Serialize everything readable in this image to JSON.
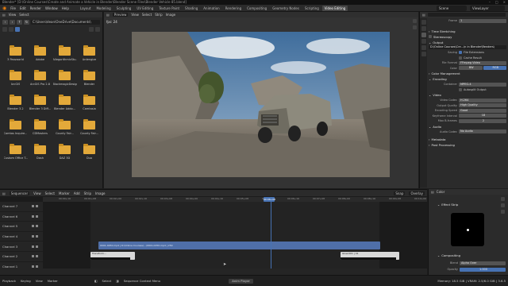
{
  "titlebar": {
    "text": "Blender* [D:\\Online Courses\\Create and Animate a Vehicle in Blender\\Blender Scene Files\\Blender Vehicle 85.blend]"
  },
  "menubar": {
    "menus": [
      "File",
      "Edit",
      "Render",
      "Window",
      "Help"
    ],
    "workspaces": [
      "Layout",
      "Modeling",
      "Sculpting",
      "UV Editing",
      "Texture Paint",
      "Shading",
      "Animation",
      "Rendering",
      "Compositing",
      "Geometry Nodes",
      "Scripting",
      "Video Editing"
    ],
    "active_workspace": "Video Editing",
    "scene": "Scene",
    "view_layer": "ViewLayer"
  },
  "file_browser": {
    "header_items": [
      "View",
      "Select"
    ],
    "path": "C:\\Users\\dean\\OneDrive\\Documents\\",
    "folders": [
      "3 Passworld",
      "Adobe",
      "AllegorithmicStu...",
      "Ardengize",
      "ArcGIS",
      "ArcGIS Pro 2.8",
      "BlackmagicDesign",
      "Blender",
      "Blender 3.2",
      "Blender 3 Diff...",
      "Blender Addo...",
      "Camtasia",
      "Camtas Inquire...",
      "CDMasters",
      "County Fair...",
      "County Fair...",
      "Custom Office T...",
      "Dash",
      "DAZ 3D",
      "Duo"
    ]
  },
  "preview": {
    "header_items": [
      "View",
      "Select",
      "Strip",
      "Image"
    ],
    "mode": "Preview",
    "fps": "fps: 24"
  },
  "properties": {
    "frame_label": "Frame",
    "frame_value": "1",
    "fields": {
      "time_stretching": "Time Stretching",
      "stereoscopy": "Stereoscopy",
      "output": "Output",
      "output_path": "D:\\Online Courses\\Cre...\\n in Blender\\Renders\\",
      "saving": "Saving",
      "file_extensions": "File Extensions",
      "cache_result": "Cache Result",
      "file_format_label": "File Format",
      "file_format": "FFmpeg Video",
      "color_label": "Color",
      "color_bw": "BW",
      "color_rgb": "RGB",
      "color_management": "Color Management",
      "encoding": "Encoding",
      "container_label": "Container",
      "container": "MPEG-4",
      "autosplit": "Autosplit Output",
      "video": "Video",
      "codec_label": "Video Codec",
      "codec": "H.264",
      "quality_label": "Output Quality",
      "quality": "High Quality",
      "speed_label": "Encoding Speed",
      "speed": "Good",
      "keyframe_label": "Keyframe Interval",
      "keyframe": "18",
      "bframes_label": "Max B-frames",
      "bframes": "2",
      "audio": "Audio",
      "audio_codec_label": "Audio Codec",
      "audio_codec": "No Audio",
      "metadata": "Metadata",
      "post_processing": "Post Processing"
    }
  },
  "sequencer": {
    "header_items": [
      "Sequencer",
      "View",
      "Select",
      "Marker",
      "Add",
      "Strip",
      "Image"
    ],
    "snap_label": "Snap",
    "overlay_label": "Overlay",
    "ruler_ticks": [
      "00:00+16",
      "00:01+08",
      "00:02+00",
      "00:02+16",
      "00:03+08",
      "00:04+00",
      "00:04+16",
      "00:05+08",
      "00:06+00",
      "00:06+16",
      "00:07+08",
      "00:08+00",
      "00:08+16",
      "00:09+08",
      "00:10+00"
    ],
    "playhead_time": "00:06+08",
    "channels": [
      "Channel 7",
      "Channel 6",
      "Channel 5",
      "Channel 4",
      "Channel 3",
      "Channel 2",
      "Channel 1"
    ],
    "strips": {
      "main": "0001-0250.mp4 | D:\\Online Courses\\...\\0001-0250.mp4 | 250",
      "small_left": "Transform...",
      "small_right": "Glow.001 | 41"
    }
  },
  "strip_props": {
    "tab": "Color",
    "effect_strip": "Effect Strip",
    "compositing": "Compositing",
    "blend_label": "Blend",
    "blend": "Alpha Over",
    "opacity_label": "Opacity",
    "opacity": "1.000"
  },
  "statusbar": {
    "items": [
      "Playback",
      "Keying",
      "View",
      "Marker"
    ],
    "hints": [
      "Select",
      "Sequence Context Menu"
    ],
    "center": "Anim Player",
    "stats": "Memory: 18.5 GiB | VRAM: 2.5/6.0 GiB | 3.6.5"
  },
  "colors": {
    "accent": "#4772b3",
    "strip_main": "#4f6fa8",
    "strip_effect": "#d8d8d8",
    "folder": "#e3a93a"
  }
}
